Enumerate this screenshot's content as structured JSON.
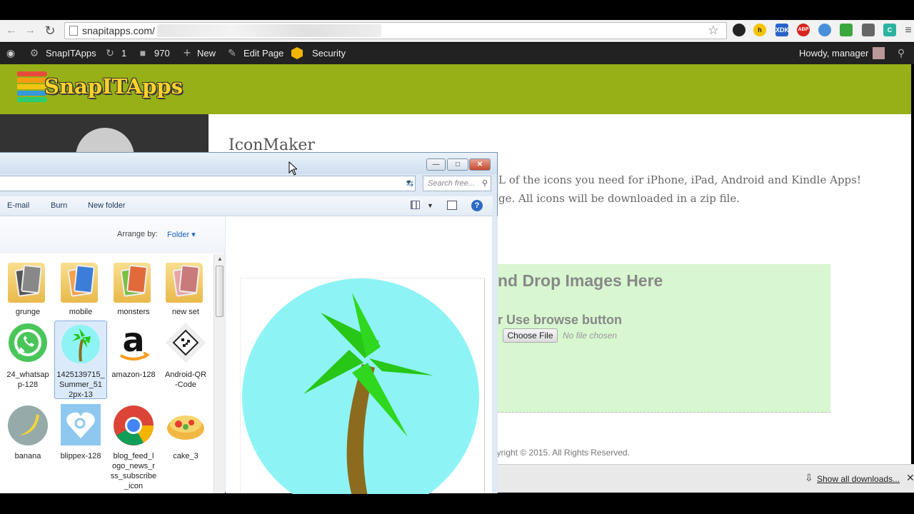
{
  "browser": {
    "url_visible": "snapitapps.com/",
    "extensions": [
      "pdf-icon",
      "honey-icon",
      "xdk-icon",
      "abp-icon",
      "cloud-icon",
      "grid-icon",
      "puzzle-icon",
      "c-icon"
    ],
    "abp_label": "ABP",
    "xdk_label": "XDK",
    "honey_label": "h",
    "c_label": "C"
  },
  "adminbar": {
    "site_name": "SnapITApps",
    "updates_count": "1",
    "comments_count": "970",
    "new_label": "New",
    "edit_label": "Edit Page",
    "security_label": "Security",
    "howdy": "Howdy, manager"
  },
  "site": {
    "logo_text": "SnapITApps",
    "brand_color": "#97b017"
  },
  "main": {
    "title": "IconMaker",
    "para1": "L of the icons you need for iPhone, iPad, Android and Kindle Apps!",
    "para2": "ge. All icons will be downloaded in a zip file.",
    "drop_title": "nd Drop Images Here",
    "drop_sub": "r Use browse button",
    "choose_file": "Choose File",
    "no_file": "No file chosen",
    "copyright": "pyright © 2015. All Rights Reserved."
  },
  "downloads": {
    "show_all": "Show all downloads..."
  },
  "explorer": {
    "search_placeholder": "Search free...",
    "commands": [
      "E-mail",
      "Burn",
      "New folder"
    ],
    "arrange_label": "Arrange by:",
    "arrange_value": "Folder",
    "files": [
      {
        "label": "grunge",
        "type": "folder",
        "selected": false
      },
      {
        "label": "mobile",
        "type": "folder",
        "selected": false
      },
      {
        "label": "monsters",
        "type": "folder",
        "selected": false
      },
      {
        "label": "new set",
        "type": "folder",
        "selected": false
      },
      {
        "label": "24_whatsapp-128",
        "type": "image",
        "selected": false
      },
      {
        "label": "1425139715_Summer_512px-13",
        "type": "image",
        "selected": true
      },
      {
        "label": "amazon-128",
        "type": "image",
        "selected": false
      },
      {
        "label": "Android-QR-Code",
        "type": "image",
        "selected": false
      },
      {
        "label": "banana",
        "type": "image",
        "selected": false
      },
      {
        "label": "blippex-128",
        "type": "image",
        "selected": false
      },
      {
        "label": "blog_feed_logo_news_rss_subscribe_icon",
        "type": "image",
        "selected": false
      },
      {
        "label": "cake_3",
        "type": "image",
        "selected": false
      }
    ],
    "label_lines": {
      "f4": [
        "24_whatsap",
        "p-128"
      ],
      "f5": [
        "1425139715_",
        "Summer_51",
        "2px-13"
      ],
      "f7": [
        "Android-QR",
        "-Code"
      ],
      "f10": [
        "blog_feed_l",
        "ogo_news_r",
        "ss_subscribe",
        "_icon"
      ]
    }
  }
}
